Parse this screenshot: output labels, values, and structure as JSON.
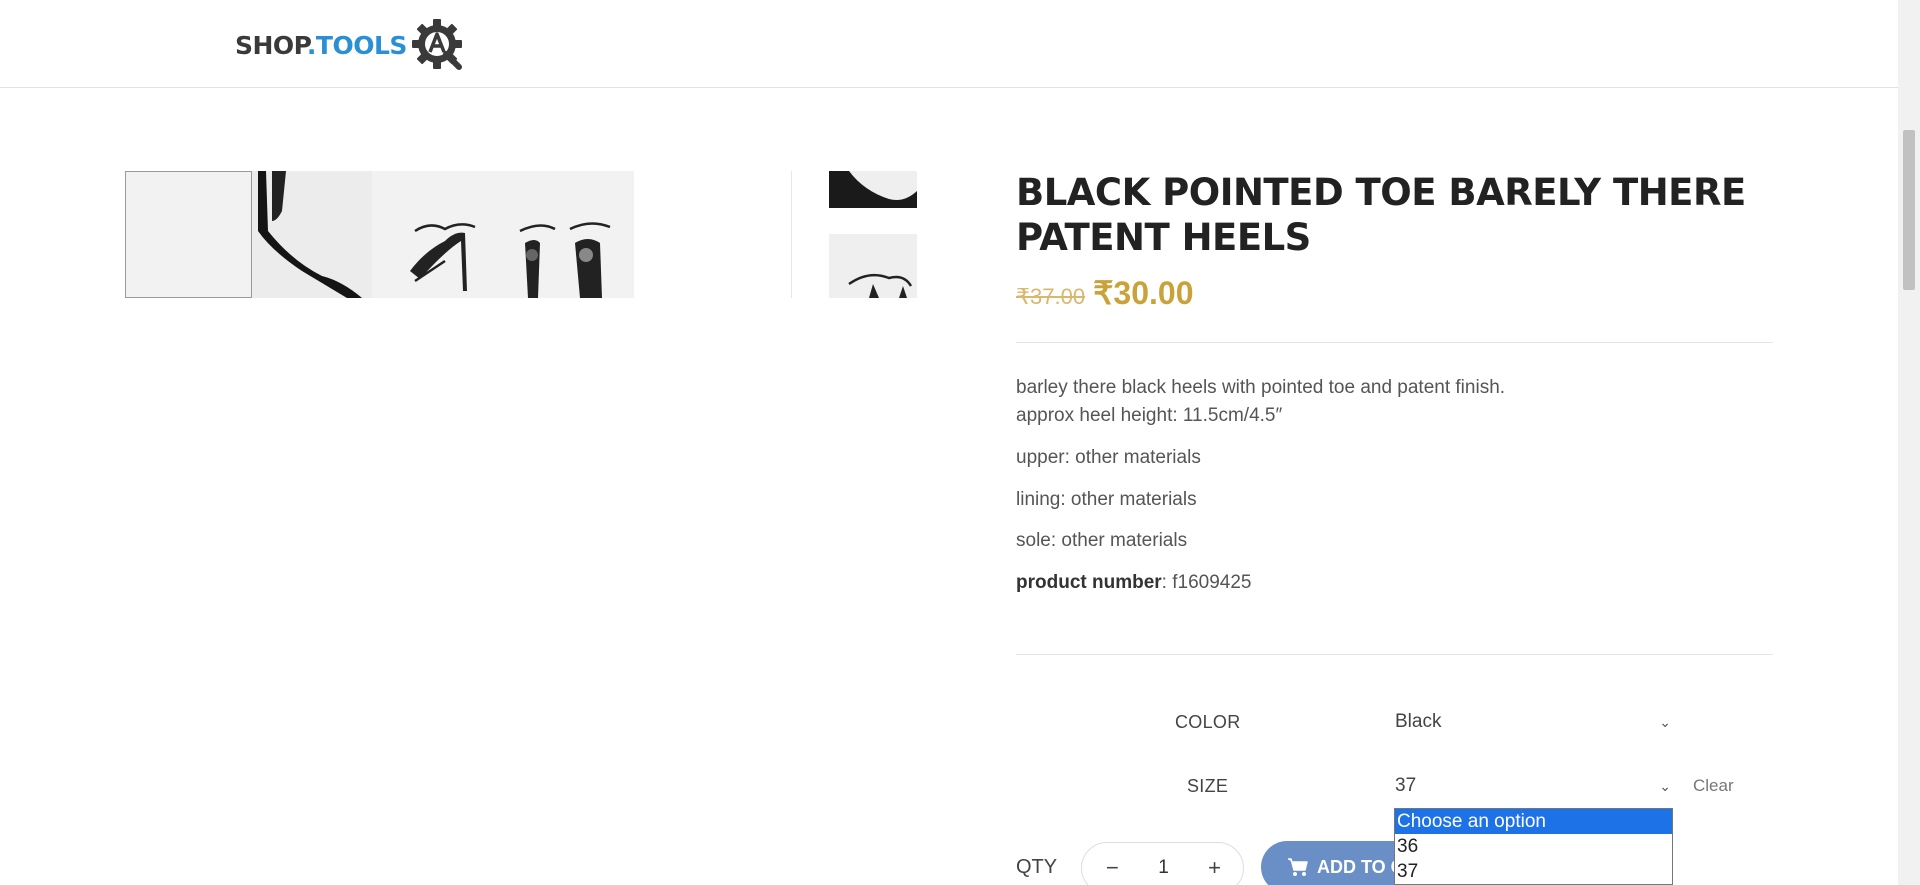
{
  "header": {
    "logo_shop": "SHOP",
    "logo_tools": ".TOOLS"
  },
  "product": {
    "title": "BLACK POINTED TOE BARELY THERE PATENT HEELS",
    "price_old": "₹37.00",
    "price_new": "₹30.00",
    "description": {
      "line1": "barley there black heels with pointed toe and patent finish.",
      "line2": "approx heel height: 11.5cm/4.5″",
      "upper": "upper: other materials",
      "lining": "lining: other materials",
      "sole": "sole: other materials",
      "product_number_label": "product number",
      "product_number_value": ": f1609425"
    }
  },
  "variations": {
    "color_label": "COLOR",
    "color_value": "Black",
    "size_label": "SIZE",
    "size_value": "37",
    "clear_label": "Clear",
    "size_options": [
      "Choose an option",
      "36",
      "37"
    ]
  },
  "cart": {
    "qty_label": "QTY",
    "qty_value": "1",
    "minus": "−",
    "plus": "+",
    "add_label": "ADD TO CART"
  },
  "icons": {
    "logo": "gear-magnifier-logo-icon",
    "cart": "cart-icon",
    "chevron": "chevron-down-icon"
  },
  "colors": {
    "brand_blue": "#2b8fd6",
    "price_gold": "#c9a23a",
    "button_blue": "#6a8fc7",
    "dropdown_highlight": "#1e72e8"
  }
}
